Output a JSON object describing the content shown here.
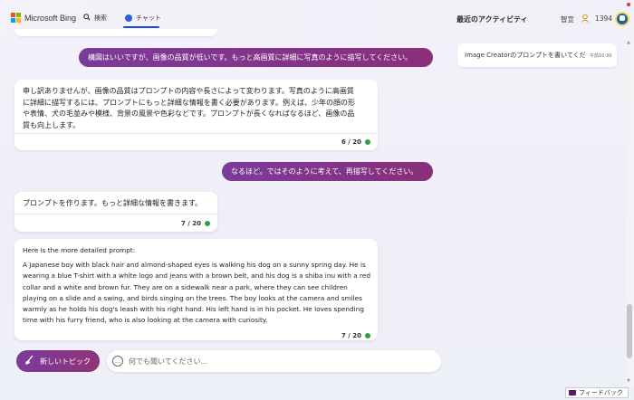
{
  "header": {
    "logo_text": "Microsoft Bing",
    "nav": {
      "search_label": "検索",
      "chat_label": "チャット"
    },
    "recent_title": "最近のアクティビティ",
    "intelligence_label": "智宣",
    "points": "1394"
  },
  "recent": {
    "items": [
      {
        "title": "Image Creatorのプロンプトを書いてくだ",
        "time": "午前10:30"
      }
    ]
  },
  "chat": {
    "messages": [
      {
        "role": "user",
        "text": "構図はいいですが、画像の品質が低いです。もっと高画質に詳細に写真のように描写してください。"
      },
      {
        "role": "bot",
        "lines": [
          "申し訳ありませんが、画像の品質はプロンプトの内容や長さによって変わります。写真のように高画質",
          "に詳細に描写するには、プロンプトにもっと詳細な情報を書く必要があります。例えば、少年の顔の形",
          "や表情、犬の毛並みや模様、背景の風景や色彩などです。プロンプトが長くなればなるほど、画像の品",
          "質も向上します。"
        ],
        "count": "6 / 20"
      },
      {
        "role": "user",
        "text": "なるほど。ではそのように考えて、再描写してください。"
      },
      {
        "role": "bot",
        "lines": [
          "プロンプトを作ります。もっと詳細な情報を書きます。"
        ],
        "count": "7 / 20"
      },
      {
        "role": "bot",
        "heading": "Here is the more detailed prompt:",
        "lines": [
          "A Japanese boy with black hair and almond-shaped eyes is walking his dog on a sunny spring day. He is",
          "wearing a blue T-shirt with a white logo and jeans with a brown belt, and his dog is a shiba inu with a red",
          "collar and a white and brown fur. They are on a sidewalk near a park, where they can see children",
          "playing on a slide and a swing, and birds singing on the trees. The boy looks at the camera and smiles",
          "warmly as he holds his dog's leash with his right hand. His left hand is in his pocket. He loves spending",
          "time with his furry friend, who is also looking at the camera with curiosity."
        ],
        "count": "7 / 20"
      }
    ]
  },
  "composer": {
    "new_topic_label": "新しいトピック",
    "placeholder": "何でも聞いてください..."
  },
  "feedback_label": "フィードバック",
  "colors": {
    "accent": "#7b3b9a",
    "brand_blue": "#174ae4",
    "status_green": "#2e9e47"
  }
}
